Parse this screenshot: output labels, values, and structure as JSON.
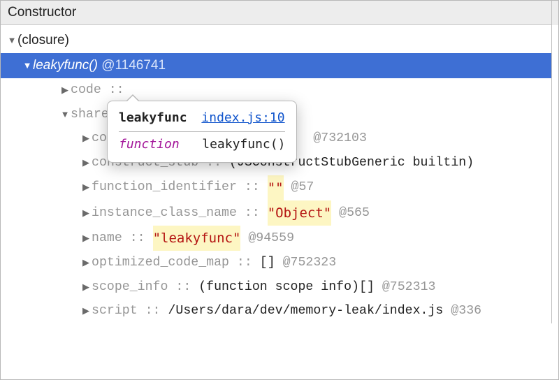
{
  "header": {
    "title": "Constructor"
  },
  "tree": {
    "root": {
      "label": "(closure)"
    },
    "selected": {
      "name": "leakyfunc()",
      "id": "@1146741"
    },
    "children": [
      {
        "key": "code",
        "sep": "::",
        "partial": true
      },
      {
        "key": "shared",
        "expanded": true
      }
    ],
    "shared_children": [
      {
        "key": "code",
        "dim_tail": "@732103"
      },
      {
        "key": "construct_stub",
        "sep": "::",
        "val": "(JSConstructStubGeneric builtin)"
      },
      {
        "key": "function_identifier",
        "sep": "::",
        "str": "\"\"",
        "id": "@57"
      },
      {
        "key": "instance_class_name",
        "sep": "::",
        "str": "\"Object\"",
        "id": "@565"
      },
      {
        "key": "name",
        "sep": "::",
        "str": "\"leakyfunc\"",
        "id": "@94559"
      },
      {
        "key": "optimized_code_map",
        "sep": "::",
        "val": "[]",
        "id": "@752323"
      },
      {
        "key": "scope_info",
        "sep": "::",
        "val": "(function scope info)[]",
        "id": "@752313"
      },
      {
        "key": "script",
        "sep": "::",
        "val": "/Users/dara/dev/memory-leak/index.js",
        "id": "@336"
      }
    ]
  },
  "popover": {
    "fname": "leakyfunc",
    "link": "index.js:10",
    "keyword": "function",
    "sig": "leakyfunc()"
  }
}
